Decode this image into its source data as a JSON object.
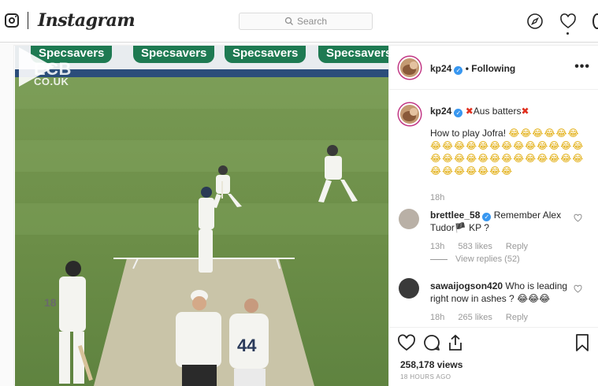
{
  "nav": {
    "wordmark": "Instagram",
    "search_placeholder": "Search"
  },
  "video": {
    "watermark_big": "ECB",
    "watermark_small": "CO.UK",
    "ad_boards": [
      "Specsavers",
      "Specsavers",
      "Specsavers",
      "Specsavers"
    ],
    "shirt_numbers": [
      "18",
      "44"
    ]
  },
  "post": {
    "author": "kp24",
    "follow_status": "• Following",
    "more_label": "•••",
    "caption": {
      "user": "kp24",
      "title": "Aus batters",
      "title_mark": "✖",
      "body": "How to play Jofra!",
      "emoji_line": "😂😂😂😂😂😂😂😂😂😂😂😂😂😂😂😂😂😂😂😂😂😂😂😂😂😂😂😂😂😂😂😂😂😂😂😂😂😂😂",
      "time": "18h"
    },
    "comments": [
      {
        "user": "brettlee_58",
        "text": "Remember Alex Tudor🏴 KP ?",
        "time": "13h",
        "likes": "583 likes",
        "reply": "Reply",
        "view_replies": "View replies (52)"
      },
      {
        "user": "sawaijogson420",
        "text": "Who is leading right now in ashes ? 😂😂😂",
        "time": "18h",
        "likes": "265 likes",
        "reply": "Reply"
      }
    ],
    "views": "258,178 views",
    "posted": "18 HOURS AGO"
  }
}
